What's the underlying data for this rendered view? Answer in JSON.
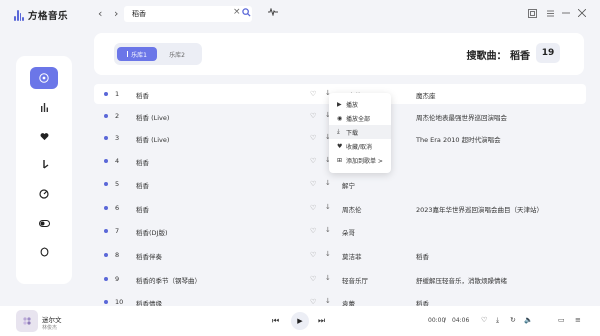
{
  "app": {
    "name": "方格音乐"
  },
  "search": {
    "value": "稻香",
    "clear": "×"
  },
  "tabs": [
    {
      "label": "乐库1",
      "active": true
    },
    {
      "label": "乐库2",
      "active": false
    }
  ],
  "result": {
    "title": "搜歌曲：  稻香",
    "count": "19"
  },
  "colors": {
    "accent": "#6b76e8",
    "dot": "#5a67d8"
  },
  "sidebar": {
    "items": [
      {
        "icon": "music-disc-icon",
        "active": true
      },
      {
        "icon": "bar-chart-icon",
        "active": false
      },
      {
        "icon": "heart-icon",
        "active": false
      },
      {
        "icon": "download-icon",
        "active": false
      },
      {
        "icon": "compass-icon",
        "active": false
      },
      {
        "icon": "toggle-icon",
        "active": false
      },
      {
        "icon": "leaf-icon",
        "active": false
      }
    ]
  },
  "songs": [
    {
      "num": "1",
      "title": "稻香",
      "artist": "周杰伦",
      "album": "魔杰座",
      "active": true
    },
    {
      "num": "2",
      "title": "稻香 (Live)",
      "artist": "",
      "album": "周杰伦地表最强世界巡回演唱会"
    },
    {
      "num": "3",
      "title": "稻香 (Live)",
      "artist": "",
      "album": "The Era 2010 超时代演唱会"
    },
    {
      "num": "4",
      "title": "稻香",
      "artist": "",
      "album": ""
    },
    {
      "num": "5",
      "title": "稻香",
      "artist": "解宁",
      "album": ""
    },
    {
      "num": "6",
      "title": "稻香",
      "artist": "周杰伦",
      "album": "2023嘉年华世界巡回演唱会曲目（天津站）"
    },
    {
      "num": "7",
      "title": "稻香(DJ版)",
      "artist": "朵哥",
      "album": ""
    },
    {
      "num": "8",
      "title": "稻香伴奏",
      "artist": "莫洁菲",
      "album": "稻香"
    },
    {
      "num": "9",
      "title": "稻香的季节（钢琴曲）",
      "artist": "轻音乐厅",
      "album": "舒缓解压轻音乐，消散烦躁情绪"
    },
    {
      "num": "10",
      "title": "稻香情缘",
      "artist": "袁蕾",
      "album": "稻香"
    }
  ],
  "context_menu": {
    "items": [
      {
        "label": "播放",
        "icon": "play-icon"
      },
      {
        "label": "播放全部",
        "icon": "play-all-icon"
      },
      {
        "label": "下载",
        "icon": "download-icon",
        "hover": true
      },
      {
        "label": "收藏/取消",
        "icon": "heart-icon"
      },
      {
        "label": "添加到歌单 >",
        "icon": "add-playlist-icon"
      }
    ]
  },
  "player": {
    "song": "迷尔文",
    "artist": "林俊杰",
    "current_time": "00:00",
    "separator": "/",
    "total_time": "04:06"
  }
}
